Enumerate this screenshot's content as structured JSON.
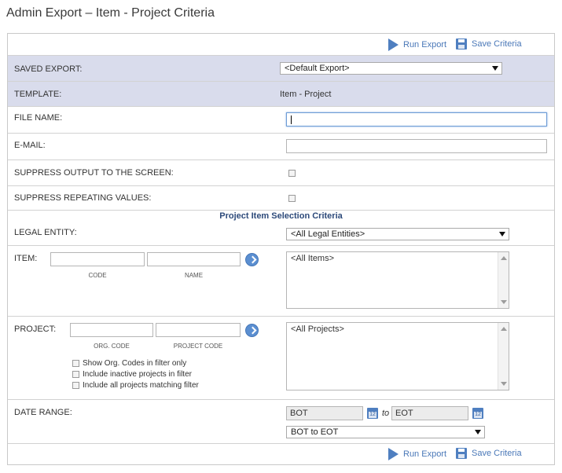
{
  "page": {
    "title": "Admin Export – Item - Project Criteria"
  },
  "toolbar": {
    "run_label": "Run Export",
    "save_label": "Save Criteria"
  },
  "fields": {
    "saved_export": {
      "label": "SAVED EXPORT:",
      "value": "<Default Export>"
    },
    "template": {
      "label": "TEMPLATE:",
      "value": "Item - Project"
    },
    "file_name": {
      "label": "FILE NAME:",
      "value": ""
    },
    "email": {
      "label": "E-MAIL:",
      "value": ""
    },
    "suppress_output": {
      "label": "SUPPRESS OUTPUT TO THE SCREEN:"
    },
    "suppress_repeating": {
      "label": "SUPPRESS REPEATING VALUES:"
    }
  },
  "section": {
    "title": "Project Item Selection Criteria"
  },
  "legal_entity": {
    "label": "LEGAL ENTITY:",
    "value": "<All Legal Entities>"
  },
  "item": {
    "label": "ITEM:",
    "code_label": "CODE",
    "name_label": "NAME",
    "list": [
      "<All Items>"
    ]
  },
  "project": {
    "label": "PROJECT:",
    "org_code_label": "ORG. CODE",
    "project_code_label": "PROJECT CODE",
    "list": [
      "<All Projects>"
    ],
    "options": [
      "Show Org. Codes in filter only",
      "Include inactive projects in filter",
      "Include all projects matching filter"
    ]
  },
  "date_range": {
    "label": "DATE RANGE:",
    "from": "BOT",
    "to_word": "to",
    "to": "EOT",
    "preset": "BOT to EOT",
    "cal_num": "12"
  },
  "colors": {
    "accent": "#4f7fc0",
    "shaded_row": "#d9dcec",
    "section_title": "#2d4a7a"
  }
}
